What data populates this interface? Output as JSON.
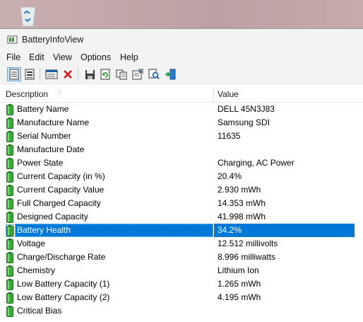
{
  "window": {
    "title": "BatteryInfoView"
  },
  "menu": [
    "File",
    "Edit",
    "View",
    "Options",
    "Help"
  ],
  "toolbar": {
    "buttons": [
      {
        "name": "properties-view-button",
        "icon": "properties-icon",
        "pressed": true
      },
      {
        "name": "list-view-button",
        "icon": "list-icon",
        "pressed": false
      },
      {
        "name": "log-window-button",
        "icon": "window-icon",
        "pressed": false
      },
      {
        "name": "delete-button",
        "icon": "red-x-icon",
        "pressed": false
      },
      {
        "name": "save-button",
        "icon": "floppy-disk-icon",
        "pressed": false
      },
      {
        "name": "refresh-button",
        "icon": "refresh-icon",
        "pressed": false
      },
      {
        "name": "copy-button",
        "icon": "copy-icon",
        "pressed": false
      },
      {
        "name": "options-button",
        "icon": "properties-sheet-icon",
        "pressed": false
      },
      {
        "name": "find-button",
        "icon": "find-icon",
        "pressed": false
      },
      {
        "name": "exit-button",
        "icon": "exit-door-icon",
        "pressed": false
      }
    ]
  },
  "list": {
    "columns": {
      "description": "Description",
      "value": "Value"
    },
    "sort_indicator": "⁄",
    "rows": [
      {
        "desc": "Battery Name",
        "val": "DELL 45N3J83"
      },
      {
        "desc": "Manufacture Name",
        "val": "Samsung SDI"
      },
      {
        "desc": "Serial Number",
        "val": "11635"
      },
      {
        "desc": "Manufacture Date",
        "val": ""
      },
      {
        "desc": "Power State",
        "val": "Charging, AC Power"
      },
      {
        "desc": "Current Capacity (in %)",
        "val": "20.4%"
      },
      {
        "desc": "Current Capacity Value",
        "val": "2.930 mWh"
      },
      {
        "desc": "Full Charged Capacity",
        "val": "14.353 mWh"
      },
      {
        "desc": "Designed Capacity",
        "val": "41.998 mWh"
      },
      {
        "desc": "Battery Health",
        "val": "34.2%",
        "selected": true
      },
      {
        "desc": "Voltage",
        "val": "12.512 millivolts"
      },
      {
        "desc": "Charge/Discharge Rate",
        "val": "8.996 milliwatts"
      },
      {
        "desc": "Chemistry",
        "val": "Lithium Ion"
      },
      {
        "desc": "Low Battery Capacity (1)",
        "val": "1.265 mWh"
      },
      {
        "desc": "Low Battery Capacity (2)",
        "val": "4.195 mWh"
      },
      {
        "desc": "Critical Bias",
        "val": ""
      }
    ]
  },
  "colors": {
    "selection": "#0078d7",
    "battery_green": "#2e9d2e",
    "chrome": "#f3f3f3"
  }
}
